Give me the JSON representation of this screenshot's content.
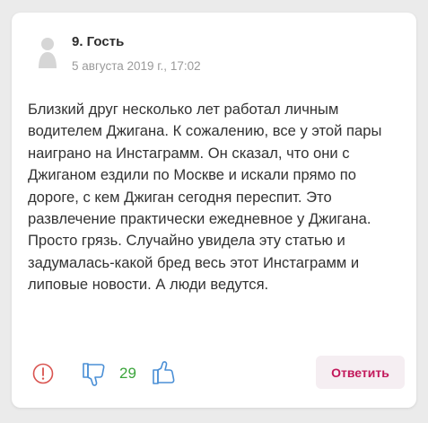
{
  "comment": {
    "author": "9. Гость",
    "date": "5 августа 2019 г., 17:02",
    "text": "Близкий друг несколько лет работал личным водителем Джигана. К сожалению, все у этой пары наиграно на Инстаграмм. Он сказал, что они с Джиганом ездили по Москве и искали прямо по дороге, с кем Джиган сегодня переспит. Это развлечение практически ежедневное у Джигана. Просто грязь. Случайно увидела эту статью и задумалась-какой бред весь этот Инстаграмм и липовые новости. А люди ведутся.",
    "rating": "29",
    "reply_label": "Ответить"
  },
  "icons": {
    "avatar": "user-silhouette-icon",
    "report": "exclamation-circle-icon",
    "dislike": "thumbs-down-icon",
    "like": "thumbs-up-icon"
  },
  "colors": {
    "report": "#d9534f",
    "rating": "#3aa43a",
    "vote_icons": "#4a8fd6",
    "reply_text": "#c2185b",
    "reply_bg": "#f5eef2",
    "date": "#9a9a9a"
  }
}
